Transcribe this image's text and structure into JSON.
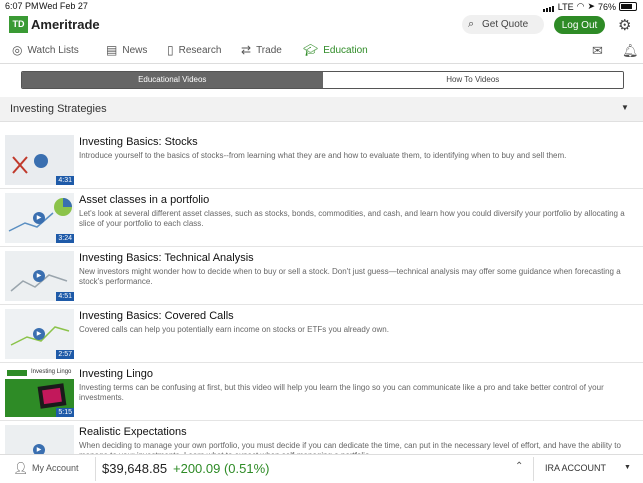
{
  "status": {
    "time": "6:07 PM",
    "date": "Wed Feb 27",
    "carrier": "LTE",
    "battery": "76%"
  },
  "header": {
    "logo_mark": "TD",
    "logo_text": "Ameritrade",
    "quote_placeholder": "Get Quote",
    "logout_label": "Log Out"
  },
  "nav": {
    "items": [
      {
        "label": "Watch Lists",
        "icon": "watchlist-icon"
      },
      {
        "label": "News",
        "icon": "news-icon"
      },
      {
        "label": "Research",
        "icon": "research-icon"
      },
      {
        "label": "Trade",
        "icon": "trade-icon"
      },
      {
        "label": "Education",
        "icon": "graduation-cap-icon",
        "active": true
      }
    ]
  },
  "tabs": {
    "educational": "Educational Videos",
    "howto": "How To Videos"
  },
  "section": {
    "label": "Investing Strategies"
  },
  "videos": [
    {
      "title": "Investing Basics: Stocks",
      "desc": "Introduce yourself to the basics of stocks--from learning what they are and how to evaluate them, to identifying when to buy and sell them.",
      "duration": "4:31"
    },
    {
      "title": "Asset classes in a portfolio",
      "desc": "Let's look at several different asset classes, such as stocks, bonds, commodities, and cash, and learn how you could diversify your portfolio by allocating a slice of your portfolio to each class.",
      "duration": "3:24"
    },
    {
      "title": "Investing Basics: Technical Analysis",
      "desc": "New investors might wonder how to decide when to buy or sell a stock.  Don't just guess—technical analysis may offer some guidance when forecasting a stock's performance.",
      "duration": "4:51"
    },
    {
      "title": "Investing Basics: Covered Calls",
      "desc": "Covered calls can help you potentially earn income on stocks or ETFs you already own.",
      "duration": "2:57"
    },
    {
      "title": "Investing Lingo",
      "desc": "Investing terms can be confusing at first, but this video will help you learn the lingo so you can communicate like a pro and take better control of your investments.",
      "duration": "5:15",
      "thumb_text": "Investing Lingo"
    },
    {
      "title": "Realistic Expectations",
      "desc": "When deciding to manage your own portfolio, you must decide if you can dedicate the time, can put in the necessary level of effort, and have the ability to manage to your investments. Learn what to expect when self-managing a portfolio.",
      "duration": ""
    }
  ],
  "footer": {
    "account_label": "My Account",
    "balance": "$39,648.85",
    "change": "+200.09 (0.51%)",
    "account_type": "IRA ACCOUNT"
  },
  "colors": {
    "brand_green": "#2e8b26",
    "duration_blue": "#1e5aa8"
  }
}
